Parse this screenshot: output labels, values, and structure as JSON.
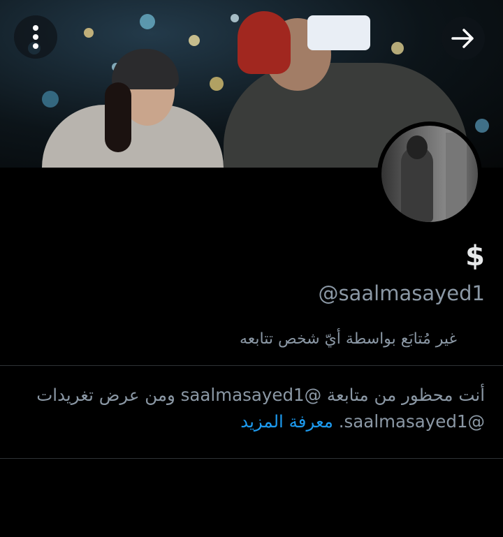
{
  "header": {
    "menu_icon": "more-vertical-icon",
    "forward_icon": "arrow-right-icon"
  },
  "profile": {
    "display_name": "$",
    "handle": "@saalmasayed1",
    "follow_note": "غير مُتابَع بواسطة أيّ شخص تتابعه"
  },
  "block_notice": {
    "text": "أنت محظور من متابعة @saalmasayed1 ومن عرض تغريدات @saalmasayed1.",
    "learn_more": "معرفة المزيد"
  },
  "colors": {
    "background": "#000000",
    "primary_text": "#e7e9ea",
    "secondary_text": "#8b98a5",
    "link": "#1d9bf0",
    "divider": "#2f3336"
  }
}
